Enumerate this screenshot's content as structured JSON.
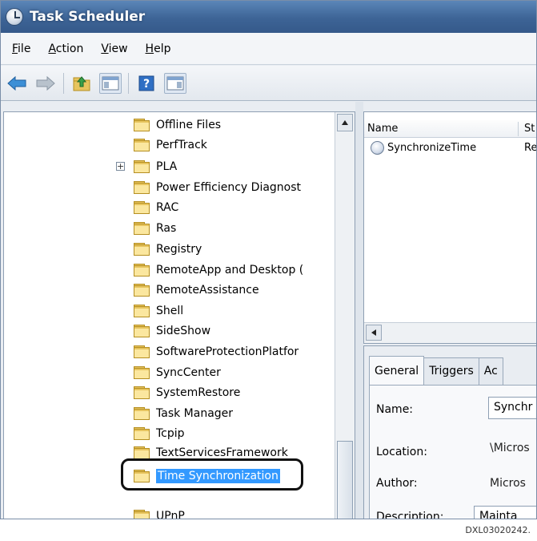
{
  "window": {
    "title": "Task Scheduler"
  },
  "menu": [
    {
      "label": "File",
      "accel": "F",
      "rest": "ile"
    },
    {
      "label": "Action",
      "accel": "A",
      "rest": "ction"
    },
    {
      "label": "View",
      "accel": "V",
      "rest": "iew"
    },
    {
      "label": "Help",
      "accel": "H",
      "rest": "elp"
    }
  ],
  "toolbar": {
    "icons": [
      "back-arrow-icon",
      "forward-arrow-icon",
      "up-folder-icon",
      "show-hide-console-tree-icon",
      "help-icon",
      "show-hide-action-pane-icon"
    ]
  },
  "tree": {
    "items": [
      "Offline Files",
      "PerfTrack",
      "PLA",
      "Power Efficiency Diagnost",
      "RAC",
      "Ras",
      "Registry",
      "RemoteApp and Desktop (",
      "RemoteAssistance",
      "Shell",
      "SideShow",
      "SoftwareProtectionPlatfor",
      "SyncCenter",
      "SystemRestore",
      "Task Manager",
      "Tcpip",
      "TextServicesFramework",
      "Time Synchronization",
      "UPnP"
    ],
    "expander_symbol": "+",
    "selected": "Time Synchronization"
  },
  "task_list": {
    "columns": [
      "Name",
      "St"
    ],
    "rows": [
      {
        "name": "SynchronizeTime",
        "status": "Re"
      }
    ]
  },
  "details": {
    "tabs": [
      "General",
      "Triggers",
      "Ac"
    ],
    "active_tab": "General",
    "fields": {
      "name_label": "Name:",
      "name_value": "Synchr",
      "location_label": "Location:",
      "location_value": "\\Micros",
      "author_label": "Author:",
      "author_value": "Micros",
      "description_label": "Description:",
      "description_value": "Mainta"
    }
  },
  "footer_code": "DXL03020242."
}
